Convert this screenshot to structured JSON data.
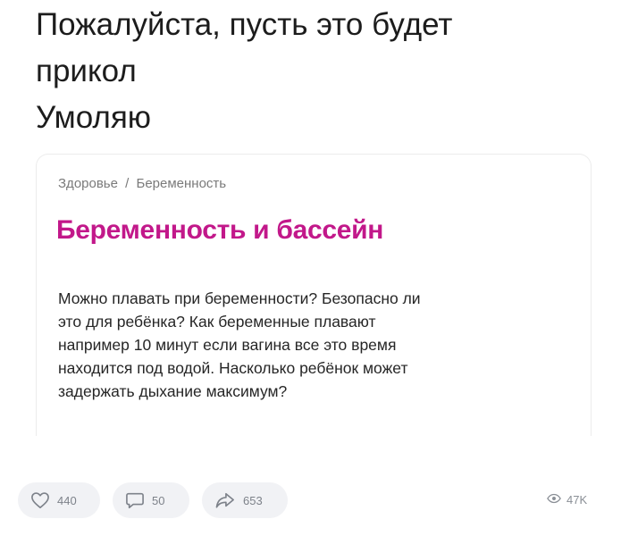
{
  "post": {
    "lines": [
      "Пожалуйста, пусть это будет",
      "прикол",
      "Умоляю"
    ]
  },
  "card": {
    "breadcrumb": [
      "Здоровье",
      "Беременность"
    ],
    "breadcrumb_separator": "/",
    "title": "Беременность и бассейн",
    "title_color": "#c2188a",
    "body_lines": [
      "Можно плавать при беременности? Безопасно ли",
      "это для ребёнка? Как беременные плавают",
      "например 10 минут если вагина все это время",
      "находится под водой. Насколько ребёнок может",
      "задержать дыхание максимум?"
    ]
  },
  "actions": {
    "likes": "440",
    "comments": "50",
    "shares": "653",
    "views": "47K",
    "icons": {
      "like": "heart-icon",
      "comment": "comment-icon",
      "share": "share-icon",
      "views": "eye-icon"
    }
  }
}
